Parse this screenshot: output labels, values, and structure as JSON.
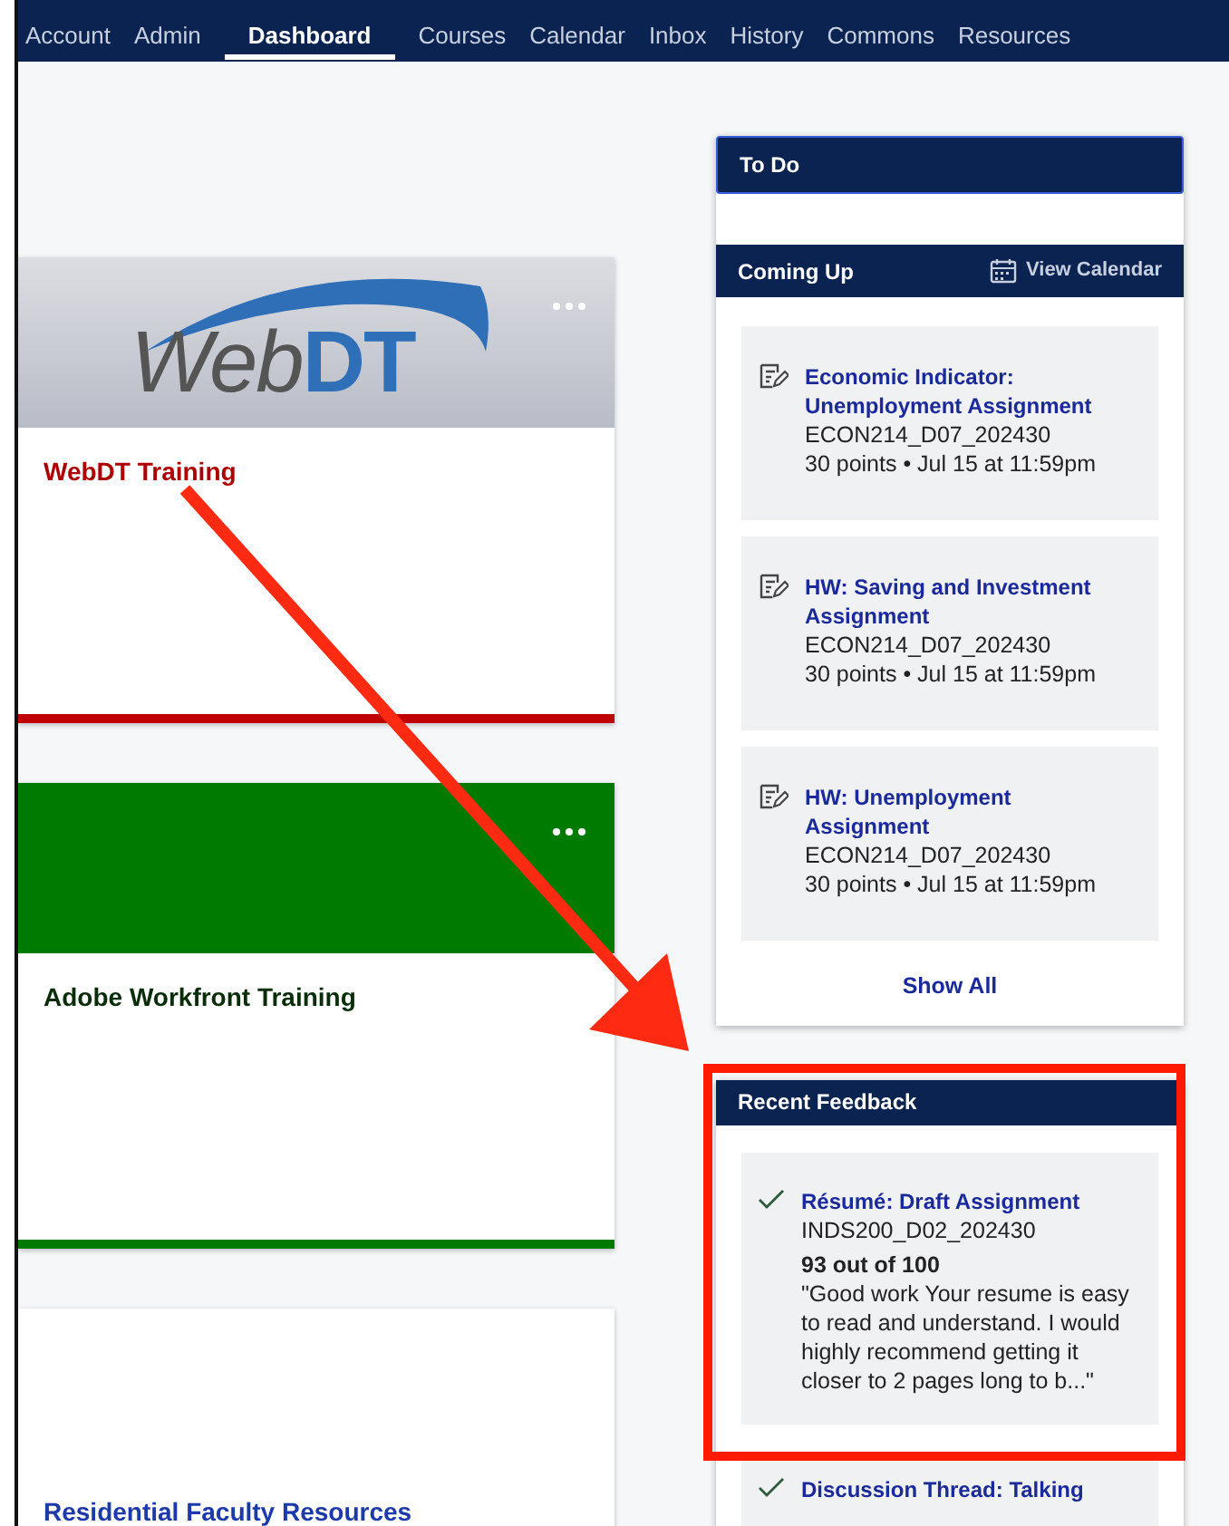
{
  "nav": {
    "items": [
      {
        "label": "Account",
        "selected": false
      },
      {
        "label": "Admin",
        "selected": false
      },
      {
        "label": "Dashboard",
        "selected": true
      },
      {
        "label": "Courses",
        "selected": false
      },
      {
        "label": "Calendar",
        "selected": false
      },
      {
        "label": "Inbox",
        "selected": false
      },
      {
        "label": "History",
        "selected": false
      },
      {
        "label": "Commons",
        "selected": false
      },
      {
        "label": "Resources",
        "selected": false
      }
    ]
  },
  "courses": [
    {
      "title": "WebDT Training",
      "kind": "image",
      "header_text": "WebDT",
      "color": "#c00000",
      "menu": true,
      "bar": true
    },
    {
      "title": "Adobe Workfront Training",
      "kind": "color",
      "color": "#007a00",
      "menu": true,
      "bar": true
    },
    {
      "title": "Residential Faculty Resources",
      "kind": "blank",
      "color": "#1c3aa9",
      "menu": false,
      "bar": false
    }
  ],
  "todo": {
    "title": "To Do"
  },
  "coming_up": {
    "title": "Coming Up",
    "calendar_link": "View Calendar",
    "items": [
      {
        "title": "Economic Indicator: Unemployment Assignment",
        "course": "ECON214_D07_202430",
        "details": "30 points • Jul 15 at 11:59pm"
      },
      {
        "title": "HW: Saving and Investment Assignment",
        "course": "ECON214_D07_202430",
        "details": "30 points • Jul 15 at 11:59pm"
      },
      {
        "title": "HW: Unemployment Assignment",
        "course": "ECON214_D07_202430",
        "details": "30 points • Jul 15 at 11:59pm"
      }
    ],
    "show_all": "Show All"
  },
  "recent_feedback": {
    "title": "Recent Feedback",
    "items": [
      {
        "title": "Résumé: Draft Assignment",
        "course": "INDS200_D02_202430",
        "score": "93 out of 100",
        "comment": "\"Good work Your resume is easy to read and understand. I would highly recommend getting it closer to 2 pages long to b...\""
      },
      {
        "title": "Discussion Thread: Talking"
      }
    ]
  },
  "annotations": {
    "arrow": true,
    "highlight_box": true
  }
}
